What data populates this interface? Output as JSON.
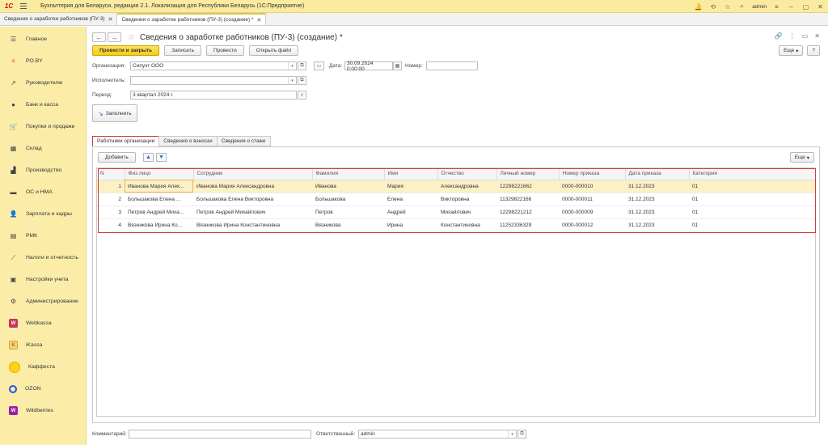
{
  "app": {
    "title": "Бухгалтерия для Беларуси, редакция 2.1. Локализация для Республики Беларусь   (1С:Предприятие)",
    "logo": "1С",
    "user": "admin"
  },
  "doc_tabs": [
    {
      "label": "Сведения о заработке работников (ПУ-3)"
    },
    {
      "label": "Сведения о заработке работников (ПУ-3) (создание) *"
    }
  ],
  "sidebar": {
    "items": [
      {
        "label": "Главное",
        "icon": "menu-icon"
      },
      {
        "label": "PO.BY",
        "icon": "sun-icon"
      },
      {
        "label": "Руководителю",
        "icon": "chart-icon"
      },
      {
        "label": "Банк и касса",
        "icon": "coin-icon"
      },
      {
        "label": "Покупки и продажи",
        "icon": "cart-icon"
      },
      {
        "label": "Склад",
        "icon": "warehouse-icon"
      },
      {
        "label": "Производство",
        "icon": "factory-icon"
      },
      {
        "label": "ОС и НМА",
        "icon": "truck-icon"
      },
      {
        "label": "Зарплата и кадры",
        "icon": "people-icon"
      },
      {
        "label": "РМК",
        "icon": "register-icon"
      },
      {
        "label": "Налоги и отчетность",
        "icon": "tax-icon"
      },
      {
        "label": "Настройки учета",
        "icon": "settings-doc-icon"
      },
      {
        "label": "Администрирование",
        "icon": "gear-icon"
      },
      {
        "label": "Webkassa",
        "icon": "webkassa-icon"
      },
      {
        "label": "iKassa",
        "icon": "ikassa-icon"
      },
      {
        "label": "Каффеста",
        "icon": "kaffesta-icon"
      },
      {
        "label": "OZON",
        "icon": "ozon-icon"
      },
      {
        "label": "Wildberries",
        "icon": "wildberries-icon"
      }
    ]
  },
  "form": {
    "title": "Сведения о заработке работников (ПУ-3) (создание) *",
    "buttons": {
      "post_close": "Провести и закрыть",
      "save": "Записать",
      "post": "Провести",
      "open_file": "Открыть файл",
      "more": "Еще",
      "help": "?"
    },
    "fields": {
      "org_label": "Организация:",
      "org_value": "Сипуэт ООО",
      "date_label": "Дата:",
      "date_value": "30.09.2024  0:00:00",
      "number_label": "Номер:",
      "number_value": "",
      "executor_label": "Исполнитель:",
      "executor_value": "",
      "period_label": "Период:",
      "period_value": "3 квартал 2024 г."
    },
    "fill_button": "Заполнить",
    "tabs": [
      {
        "label": "Работники организации",
        "active": true
      },
      {
        "label": "Сведения о взносах",
        "active": false
      },
      {
        "label": "Сведения о стаже",
        "active": false
      }
    ],
    "table_toolbar": {
      "add": "Добавить",
      "more": "Еще"
    },
    "table": {
      "columns": [
        "N",
        "Физ лицо",
        "Сотрудник",
        "Фамилия",
        "Имя",
        "Отчество",
        "Личный номер",
        "Номер приказа",
        "Дата приказа",
        "Категория"
      ],
      "rows": [
        [
          "1",
          "Иванова Мария Алек...",
          "Иванова Мария Александровна",
          "Иванова",
          "Мария",
          "Александровна",
          "12298221662",
          "0000-000010",
          "31.12.2023",
          "01"
        ],
        [
          "2",
          "Большакова Елена ...",
          "Большакова Елена Викторовна",
          "Большакова",
          "Елена",
          "Викторовна",
          "11329822166",
          "0000-000011",
          "31.12.2023",
          "01"
        ],
        [
          "3",
          "Петров Андрей Миха...",
          "Петров Андрей Михайлович",
          "Петров",
          "Андрей",
          "Михайлович",
          "12298221212",
          "0000-000009",
          "31.12.2023",
          "01"
        ],
        [
          "4",
          "Вязникова Ирина Ко...",
          "Вязникова Ирина Константиновна",
          "Вязникова",
          "Ирина",
          "Константиновна",
          "11252336329",
          "0000-000012",
          "31.12.2023",
          "01"
        ]
      ]
    },
    "footer": {
      "comment_label": "Комментарий:",
      "comment_value": "",
      "responsible_label": "Ответственный:",
      "responsible_value": "admin"
    }
  }
}
